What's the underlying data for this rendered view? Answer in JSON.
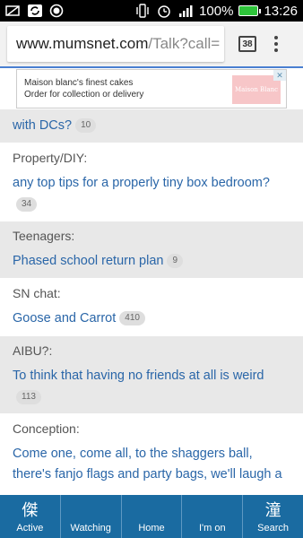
{
  "status_bar": {
    "battery_percent": "100%",
    "time": "13:26"
  },
  "browser": {
    "url_host": "www.mumsnet.com",
    "url_path": "/Talk?call=",
    "tab_count": "38"
  },
  "ad": {
    "line1": "Maison blanc's finest cakes",
    "line2": "Order for collection or delivery",
    "logo_text": "Maison Blanc",
    "corner_label": "✕"
  },
  "threads": [
    {
      "topic": "",
      "title": "with DCs?",
      "count": "10",
      "shaded": true,
      "badge_block": false
    },
    {
      "topic": "Property/DIY:",
      "title": "any top tips for a properly tiny box bedroom?",
      "count": "34",
      "shaded": false,
      "badge_block": true
    },
    {
      "topic": "Teenagers:",
      "title": "Phased school return plan",
      "count": "9",
      "shaded": true,
      "badge_block": false
    },
    {
      "topic": "SN chat:",
      "title": "Goose and Carrot",
      "count": "410",
      "shaded": false,
      "badge_block": false
    },
    {
      "topic": "AIBU?:",
      "title": "To think that having no friends at all is weird",
      "count": "113",
      "shaded": true,
      "badge_block": true
    },
    {
      "topic": "Conception:",
      "title": "Come one, come all, to the shaggers ball, there's fanjo flags and party bags, we'll laugh a",
      "count": "",
      "shaded": false,
      "badge_block": false
    }
  ],
  "nav": {
    "active": {
      "label": "Active",
      "glyph": "傑"
    },
    "watching": {
      "label": "Watching"
    },
    "home": {
      "label": "Home"
    },
    "im_on": {
      "label": "I'm on"
    },
    "search": {
      "label": "Search",
      "glyph": "潼"
    }
  }
}
